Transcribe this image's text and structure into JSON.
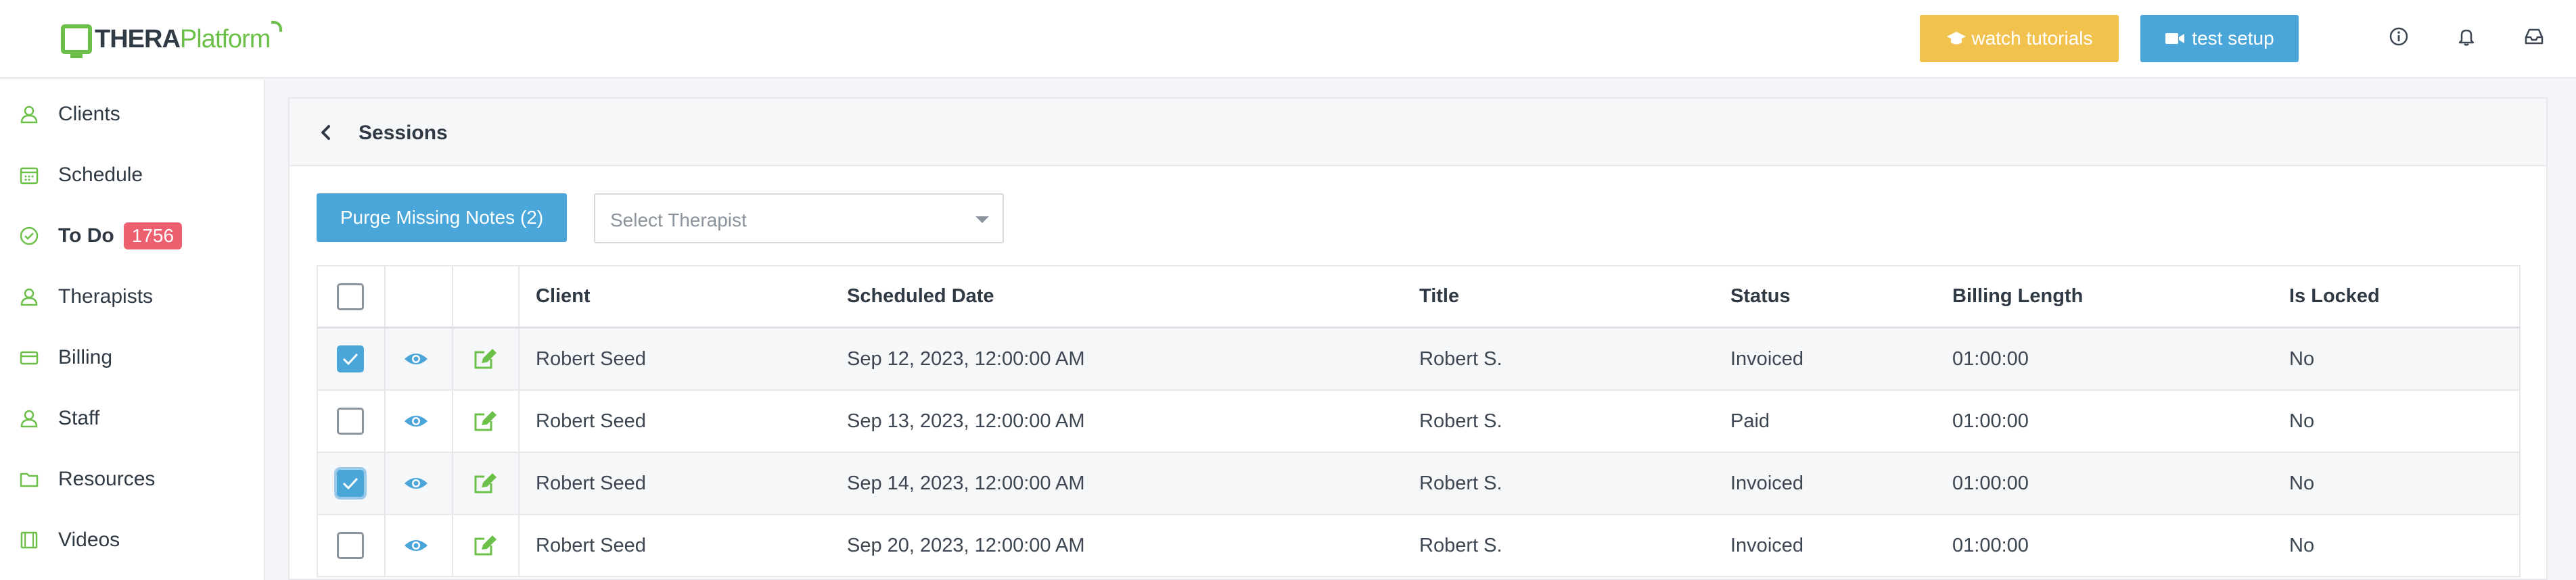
{
  "header": {
    "logo_thera": "THERA",
    "logo_platform": "Platform",
    "tutorials_label": "watch tutorials",
    "setup_label": "test setup",
    "icons": [
      "info-icon",
      "bell-icon",
      "inbox-icon"
    ]
  },
  "sidebar": {
    "items": [
      {
        "label": "Clients",
        "icon": "clients-icon"
      },
      {
        "label": "Schedule",
        "icon": "calendar-icon"
      },
      {
        "label": "To Do",
        "icon": "check-circle-icon",
        "badge": "1756"
      },
      {
        "label": "Therapists",
        "icon": "therapists-icon"
      },
      {
        "label": "Billing",
        "icon": "credit-card-icon"
      },
      {
        "label": "Staff",
        "icon": "staff-icon"
      },
      {
        "label": "Resources",
        "icon": "folder-icon"
      },
      {
        "label": "Videos",
        "icon": "film-icon"
      }
    ]
  },
  "main": {
    "title": "Sessions",
    "purge_label": "Purge Missing Notes (2)",
    "therapist_placeholder": "Select Therapist"
  },
  "table": {
    "columns": [
      "Client",
      "Scheduled Date",
      "Title",
      "Status",
      "Billing Length",
      "Is Locked"
    ],
    "rows": [
      {
        "checked": true,
        "client": "Robert Seed",
        "date": "Sep 12, 2023, 12:00:00 AM",
        "title": "Robert S.",
        "status": "Invoiced",
        "length": "01:00:00",
        "locked": "No"
      },
      {
        "checked": false,
        "client": "Robert Seed",
        "date": "Sep 13, 2023, 12:00:00 AM",
        "title": "Robert S.",
        "status": "Paid",
        "length": "01:00:00",
        "locked": "No"
      },
      {
        "checked": true,
        "client": "Robert Seed",
        "date": "Sep 14, 2023, 12:00:00 AM",
        "title": "Robert S.",
        "status": "Invoiced",
        "length": "01:00:00",
        "locked": "No"
      },
      {
        "checked": false,
        "client": "Robert Seed",
        "date": "Sep 20, 2023, 12:00:00 AM",
        "title": "Robert S.",
        "status": "Invoiced",
        "length": "01:00:00",
        "locked": "No"
      }
    ]
  },
  "colors": {
    "brand_green": "#6cc04a",
    "accent_blue": "#4aa6d9",
    "tutorial_yellow": "#f2c24f",
    "badge_red": "#ec5f6f"
  }
}
